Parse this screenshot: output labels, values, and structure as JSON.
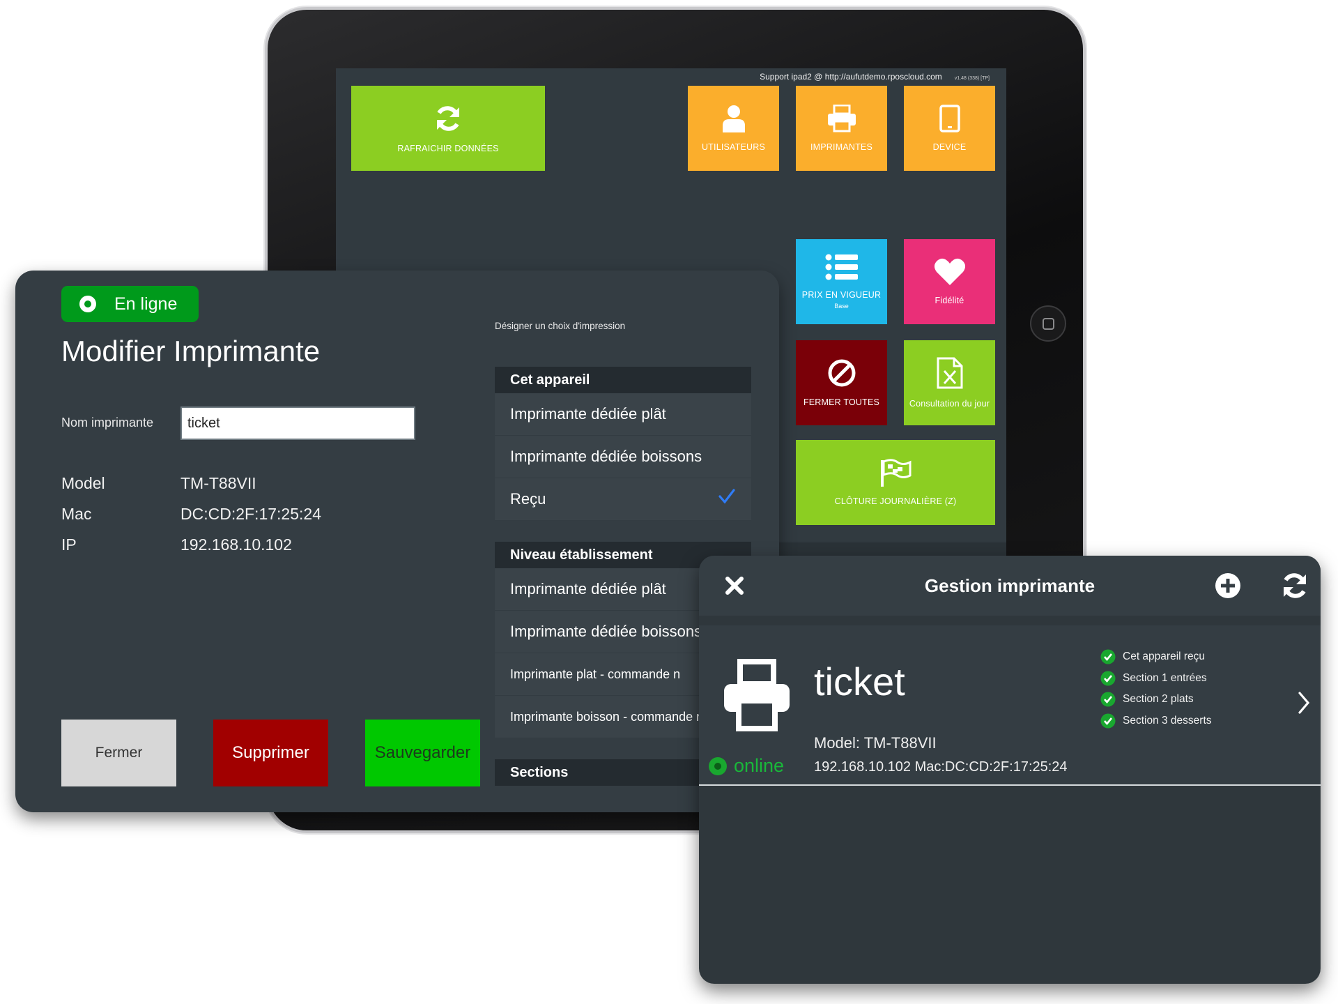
{
  "dashboard": {
    "support_text": "Support ipad2 @ http://aufutdemo.rposcloud.com",
    "version_text": "v1.48 (338) [TP]",
    "tiles": {
      "refresh": {
        "label": "RAFRAICHIR DONNÉES",
        "color": "#8cce22",
        "icon": "refresh-icon"
      },
      "users": {
        "label": "UTILISATEURS",
        "color": "#fbae2c",
        "icon": "user-icon"
      },
      "printers": {
        "label": "IMPRIMANTES",
        "color": "#fbae2c",
        "icon": "printer-icon"
      },
      "device": {
        "label": "DEVICE",
        "color": "#fbae2c",
        "icon": "tablet-icon"
      },
      "prices": {
        "label": "PRIX EN VIGUEUR",
        "sub": "Base",
        "color": "#1fb7e8",
        "icon": "list-icon"
      },
      "loyalty": {
        "label": "Fidélité",
        "color": "#ea2f78",
        "icon": "heart-icon"
      },
      "close_all": {
        "label": "FERMER TOUTES",
        "color": "#7a0008",
        "icon": "ban-icon"
      },
      "consultation": {
        "label": "Consultation du jour",
        "color": "#8cce22",
        "icon": "excel-file-icon"
      },
      "daily_close": {
        "label": "CLÔTURE JOURNALIÈRE (Z)",
        "color": "#8cce22",
        "icon": "finish-flag-icon"
      }
    }
  },
  "edit_printer": {
    "status": "En ligne",
    "title": "Modifier Imprimante",
    "name_label": "Nom imprimante",
    "name_value": "ticket",
    "info": [
      {
        "key": "Model",
        "value": "TM-T88VII"
      },
      {
        "key": "Mac",
        "value": "DC:CD:2F:17:25:24"
      },
      {
        "key": "IP",
        "value": "192.168.10.102"
      }
    ],
    "buttons": {
      "close": "Fermer",
      "delete": "Supprimer",
      "save": "Sauvegarder"
    },
    "choice_hint": "Désigner un choix d'impression",
    "sections": [
      {
        "header": "Cet appareil",
        "items": [
          {
            "label": "Imprimante dédiée plât",
            "checked": false
          },
          {
            "label": "Imprimante dédiée boissons",
            "checked": false
          },
          {
            "label": "Reçu",
            "checked": true
          }
        ]
      },
      {
        "header": "Niveau établissement",
        "items": [
          {
            "label": "Imprimante dédiée plât"
          },
          {
            "label": "Imprimante dédiée boissons"
          },
          {
            "label": "Imprimante plat - commande n"
          },
          {
            "label": "Imprimante boisson - commande n"
          }
        ]
      },
      {
        "header": "Sections"
      }
    ]
  },
  "gestion": {
    "title": "Gestion imprimante",
    "printer": {
      "name": "ticket",
      "status": "online",
      "model": "Model: TM-T88VII",
      "address": "192.168.10.102 Mac:DC:CD:2F:17:25:24",
      "capabilities": [
        "Cet appareil reçu",
        "Section 1 entrées",
        "Section 2 plats",
        "Section 3 desserts"
      ]
    }
  }
}
